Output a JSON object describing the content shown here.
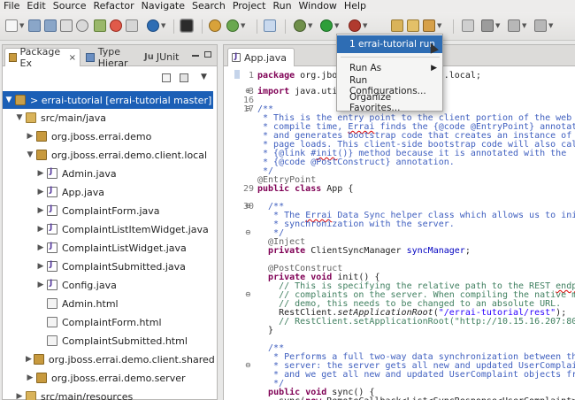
{
  "menubar": [
    "File",
    "Edit",
    "Source",
    "Refactor",
    "Navigate",
    "Search",
    "Project",
    "Run",
    "Window",
    "Help"
  ],
  "left_panel": {
    "tabs": [
      {
        "label": "Package Ex",
        "close": "×"
      },
      {
        "label": "Type Hierar"
      },
      {
        "label": "JUnit",
        "prefix": "Ju"
      }
    ],
    "tree": [
      {
        "label": "errai-tutorial  [errai-tutorial master]",
        "prefix": "> ",
        "expander": "▼",
        "icon": "project-icon",
        "selected": true
      },
      {
        "label": "src/main/java",
        "expander": "▼",
        "icon": "source-folder-icon"
      },
      {
        "label": "org.jboss.errai.demo",
        "expander": "▶",
        "icon": "package-icon"
      },
      {
        "label": "org.jboss.errai.demo.client.local",
        "expander": "▼",
        "icon": "package-icon"
      },
      {
        "label": "Admin.java",
        "expander": "▶",
        "icon": "java-file-icon"
      },
      {
        "label": "App.java",
        "expander": "▶",
        "icon": "java-file-icon"
      },
      {
        "label": "ComplaintForm.java",
        "expander": "▶",
        "icon": "java-file-icon"
      },
      {
        "label": "ComplaintListItemWidget.java",
        "expander": "▶",
        "icon": "java-file-icon"
      },
      {
        "label": "ComplaintListWidget.java",
        "expander": "▶",
        "icon": "java-file-icon"
      },
      {
        "label": "ComplaintSubmitted.java",
        "expander": "▶",
        "icon": "java-file-icon"
      },
      {
        "label": "Config.java",
        "expander": "▶",
        "icon": "java-file-icon"
      },
      {
        "label": "Admin.html",
        "expander": "",
        "icon": "html-file-icon"
      },
      {
        "label": "ComplaintForm.html",
        "expander": "",
        "icon": "html-file-icon"
      },
      {
        "label": "ComplaintSubmitted.html",
        "expander": "",
        "icon": "html-file-icon"
      },
      {
        "label": "org.jboss.errai.demo.client.shared",
        "expander": "▶",
        "icon": "package-icon"
      },
      {
        "label": "org.jboss.errai.demo.server",
        "expander": "▶",
        "icon": "package-icon"
      },
      {
        "label": "src/main/resources",
        "expander": "▶",
        "icon": "source-folder-icon"
      }
    ]
  },
  "editor": {
    "tab_label": "App.java",
    "line_numbers": [
      "1",
      "3",
      "16",
      "17",
      "",
      "",
      "",
      "",
      "",
      "",
      "",
      "",
      "",
      "29",
      "30",
      "",
      "",
      "",
      "",
      "",
      "",
      "",
      "",
      "",
      "",
      "",
      "",
      "",
      "",
      "",
      "",
      "",
      "",
      "",
      "",
      "",
      ""
    ]
  },
  "run_menu": {
    "items": [
      {
        "label": "1 errai-tutorial run",
        "highlighted": true
      },
      {
        "label": "Run As",
        "submenu": "▶"
      },
      {
        "label": "Run Configurations..."
      },
      {
        "label": "Organize Favorites..."
      }
    ]
  },
  "colors": {
    "selection": "#1b5fb6",
    "menu_highlight": "#2e6db4",
    "keyword": "#7f0055",
    "javadoc": "#3f5fbf",
    "line_comment": "#3f7f5f",
    "string": "#2a00ff"
  }
}
